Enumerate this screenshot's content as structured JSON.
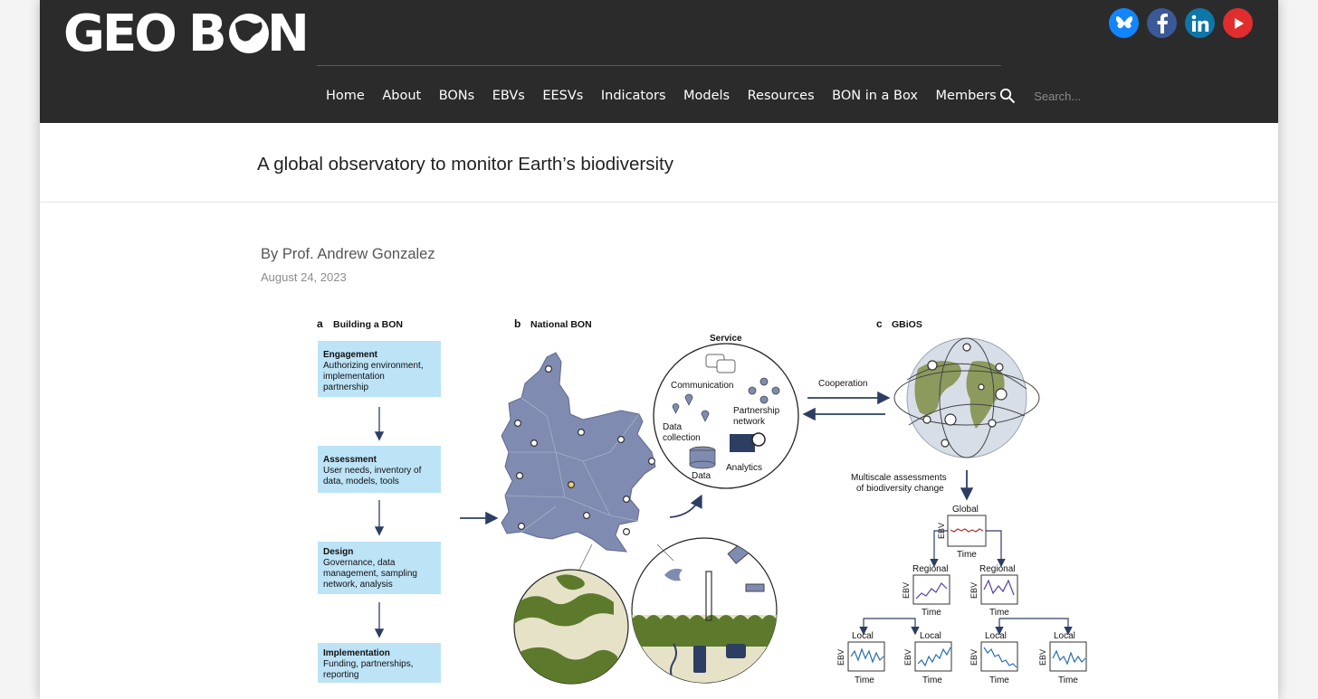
{
  "header": {
    "logo_text": "GEO BON",
    "nav": [
      "Home",
      "About",
      "BONs",
      "EBVs",
      "EESVs",
      "Indicators",
      "Models",
      "Resources",
      "BON in a Box",
      "Members"
    ],
    "search_placeholder": "Search...",
    "social_icons": [
      "bluesky-icon",
      "facebook-icon",
      "linkedin-icon",
      "youtube-icon"
    ],
    "colors": {
      "background": "#2b2b2b",
      "bluesky": "#1185fe",
      "facebook": "#3b5998",
      "linkedin": "#0e76a8",
      "youtube": "#e02d2d"
    }
  },
  "page": {
    "title": "A global observatory to monitor Earth’s biodiversity",
    "byline": "By Prof. Andrew Gonzalez",
    "date": "August 24, 2023"
  },
  "figure": {
    "panel_a": {
      "letter": "a",
      "title": "Building a BON",
      "steps": [
        {
          "title": "Engagement",
          "lines": [
            "Authorizing environment,",
            "implementation",
            "partnership"
          ]
        },
        {
          "title": "Assessment",
          "lines": [
            "User needs, inventory of",
            "data, models, tools"
          ]
        },
        {
          "title": "Design",
          "lines": [
            "Governance, data",
            "management, sampling",
            "network, analysis"
          ]
        },
        {
          "title": "Implementation",
          "lines": [
            "Funding, partnerships,",
            "reporting"
          ]
        }
      ]
    },
    "panel_b": {
      "letter": "b",
      "title": "National BON",
      "service_title": "Service",
      "service_items": [
        "Communication",
        "Partnership",
        "network",
        "Data",
        "collection",
        "Data",
        "Analytics"
      ]
    },
    "panel_c": {
      "letter": "c",
      "title": "GBiOS",
      "cooperation": "Cooperation",
      "multiscale": [
        "Multiscale assessments",
        "of biodiversity change"
      ],
      "global": "Global",
      "regional": "Regional",
      "local": "Local",
      "axis_x": "Time",
      "axis_y": "EBV"
    },
    "colors": {
      "box": "#bde3f6",
      "map": "#7f8bb0",
      "arrow": "#2d3e63",
      "forest": "#5d7a2c"
    }
  }
}
